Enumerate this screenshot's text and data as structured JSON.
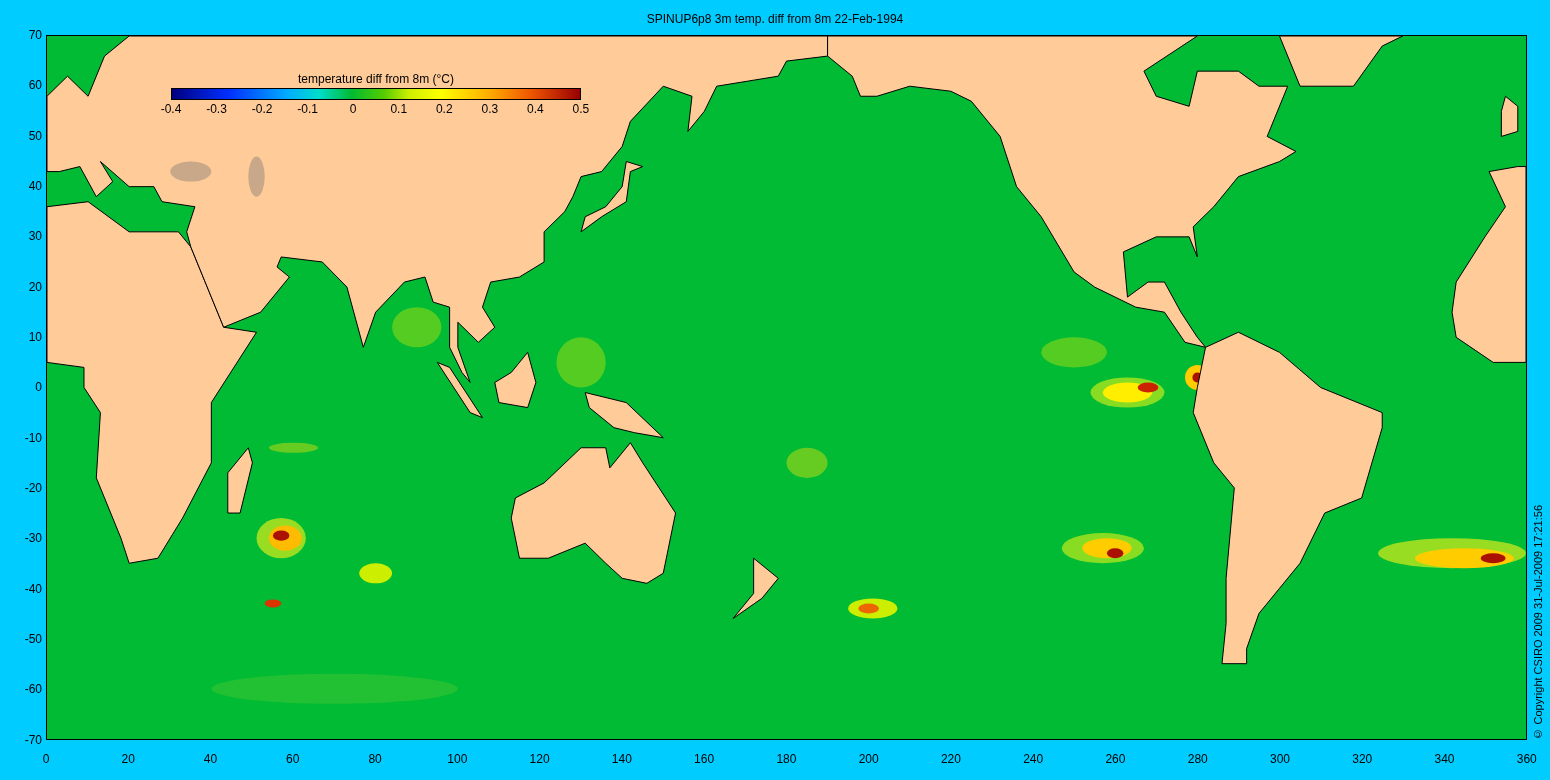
{
  "title": "SPINUP6p8 3m temp.  diff from 8m 22-Feb-1994",
  "colorbar": {
    "label": "temperature  diff from 8m (°C)",
    "ticks": [
      "-0.4",
      "-0.3",
      "-0.2",
      "-0.1",
      "0",
      "0.1",
      "0.2",
      "0.3",
      "0.4",
      "0.5"
    ]
  },
  "y_ticks": [
    "70",
    "60",
    "50",
    "40",
    "30",
    "20",
    "10",
    "0",
    "-10",
    "-20",
    "-30",
    "-40",
    "-50",
    "-60",
    "-70"
  ],
  "x_ticks": [
    "0",
    "20",
    "40",
    "60",
    "80",
    "100",
    "120",
    "140",
    "160",
    "180",
    "200",
    "220",
    "240",
    "260",
    "280",
    "300",
    "320",
    "340",
    "360"
  ],
  "copyright": "© Copyright CSIRO 2009  31-Jul-2009 17:21:56"
}
